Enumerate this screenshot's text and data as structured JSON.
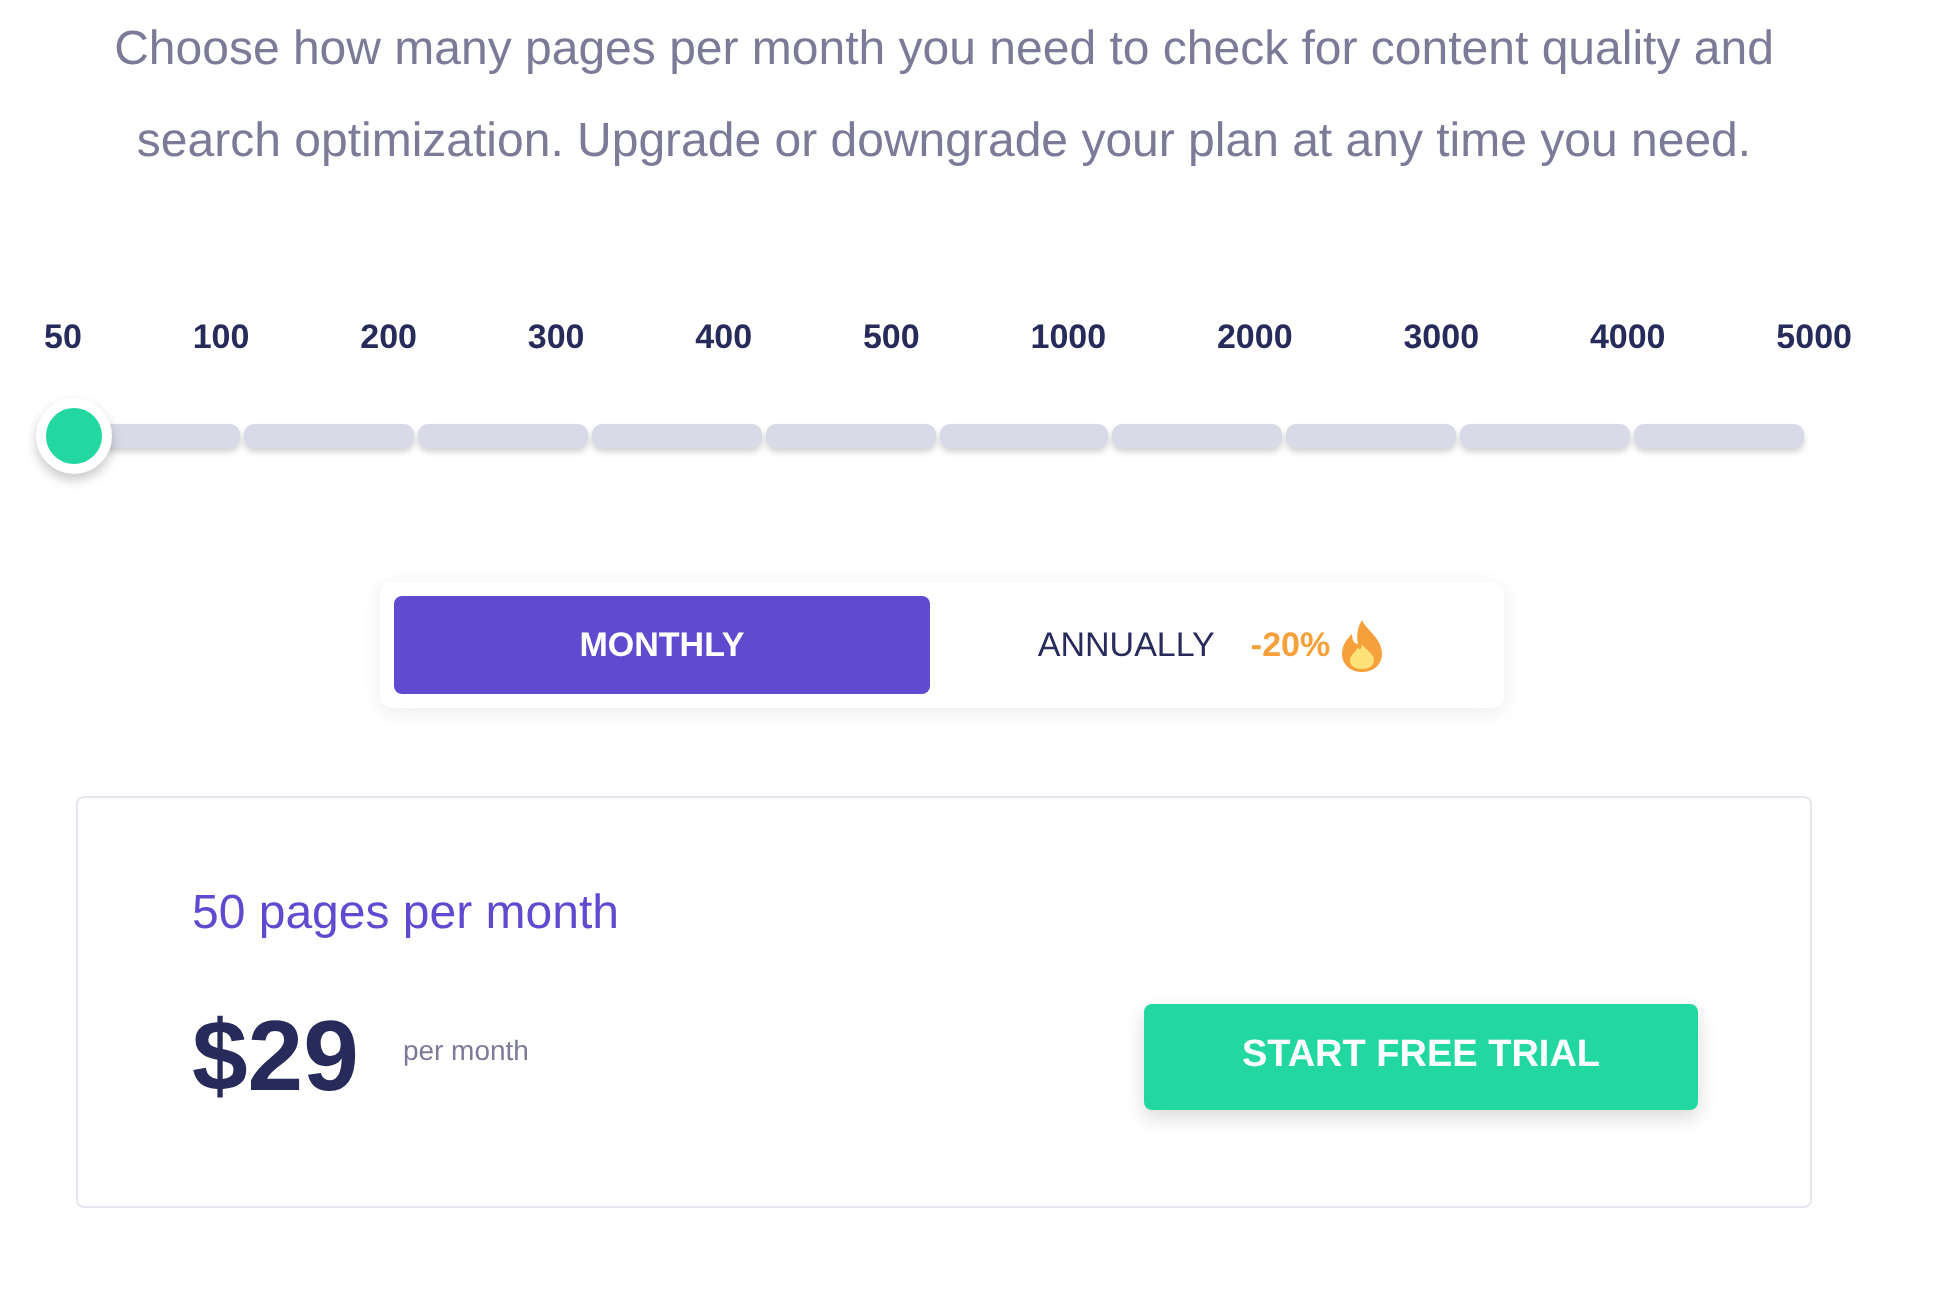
{
  "intro": "Choose how many pages per month you need to check for content quality and search optimization. Upgrade or downgrade your plan at any time you need.",
  "page_slider": {
    "stops": [
      "50",
      "100",
      "200",
      "300",
      "400",
      "500",
      "1000",
      "2000",
      "3000",
      "4000",
      "5000"
    ],
    "level": 0
  },
  "billing_toggle": {
    "options": [
      {
        "label": "MONTHLY",
        "selected": true
      },
      {
        "label": "ANNUALLY",
        "selected": false,
        "badge": "-20%"
      }
    ]
  },
  "plan_card": {
    "title": "50 pages per month",
    "price": "$29",
    "period": "per month",
    "button": "START FREE TRIAL"
  }
}
